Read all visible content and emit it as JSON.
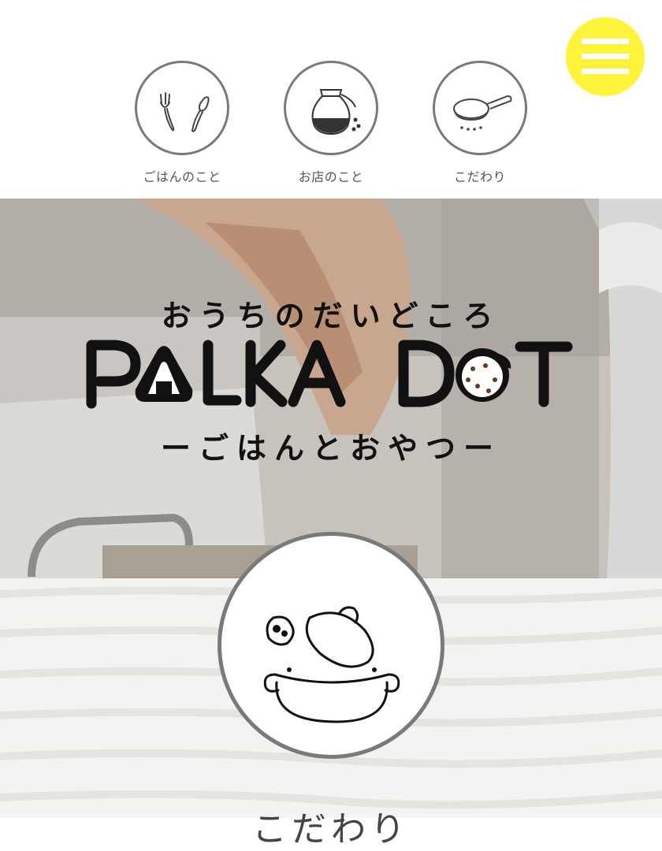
{
  "menu": {
    "icon": "hamburger-menu-icon",
    "color": "#fff23a"
  },
  "nav": [
    {
      "label": "ごはんのこと",
      "icon": "fork-spoon-icon"
    },
    {
      "label": "お店のこと",
      "icon": "coffee-pot-icon"
    },
    {
      "label": "こだわり",
      "icon": "frying-pan-icon"
    }
  ],
  "hero": {
    "tagline": "おうちのだいどころ",
    "logo": "POLKA DOT",
    "subtitle": "ーごはんとおやつー"
  },
  "feature": {
    "icon": "cooking-pot-icon",
    "title": "こだわり"
  }
}
